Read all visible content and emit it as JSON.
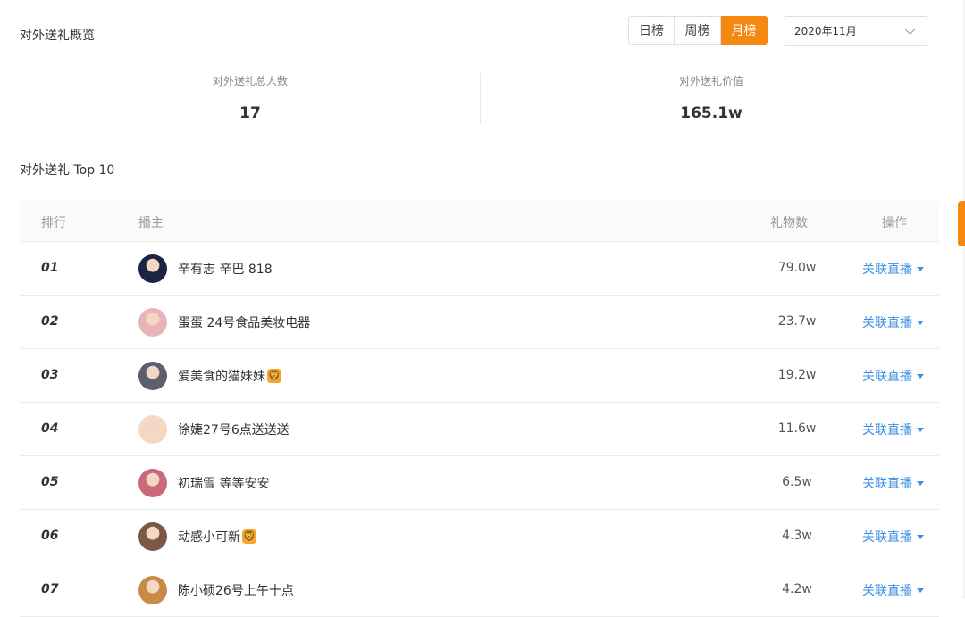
{
  "overview": {
    "title": "对外送礼概览",
    "period_buttons": [
      "日榜",
      "周榜",
      "月榜"
    ],
    "active_period": "月榜",
    "date_select": "2020年11月",
    "stats": [
      {
        "label": "对外送礼总人数",
        "value": "17"
      },
      {
        "label": "对外送礼价值",
        "value": "165.1w"
      }
    ]
  },
  "top10": {
    "title": "对外送礼 Top 10",
    "columns": {
      "rank": "排行",
      "host": "播主",
      "gifts": "礼物数",
      "action": "操作"
    },
    "rows": [
      {
        "rank": "01",
        "name": "辛有志 辛巴 818",
        "gifts": "79.0w",
        "action": "关联直播",
        "avatar": "#1b2440",
        "lion": false
      },
      {
        "rank": "02",
        "name": "蛋蛋 24号食品美妆电器",
        "gifts": "23.7w",
        "action": "关联直播",
        "avatar": "#e8b4b8",
        "lion": false
      },
      {
        "rank": "03",
        "name": "爱美食的猫妹妹",
        "gifts": "19.2w",
        "action": "关联直播",
        "avatar": "#5b5f6e",
        "lion": true
      },
      {
        "rank": "04",
        "name": "徐婕27号6点送送送",
        "gifts": "11.6w",
        "action": "关联直播",
        "avatar": "#f1d9c4",
        "lion": false
      },
      {
        "rank": "05",
        "name": "初瑞雪 等等安安",
        "gifts": "6.5w",
        "action": "关联直播",
        "avatar": "#c96a7a",
        "lion": false
      },
      {
        "rank": "06",
        "name": "动感小可新",
        "gifts": "4.3w",
        "action": "关联直播",
        "avatar": "#7a5a44",
        "lion": true
      },
      {
        "rank": "07",
        "name": "陈小硕26号上午十点",
        "gifts": "4.2w",
        "action": "关联直播",
        "avatar": "#c98a45",
        "lion": false
      }
    ]
  },
  "colors": {
    "accent": "#f7880f",
    "link": "#3a8ee6"
  },
  "icons": {
    "lion_badge": "lion-icon",
    "dropdown": "chevron-down-icon",
    "row_menu": "caret-down-icon"
  }
}
